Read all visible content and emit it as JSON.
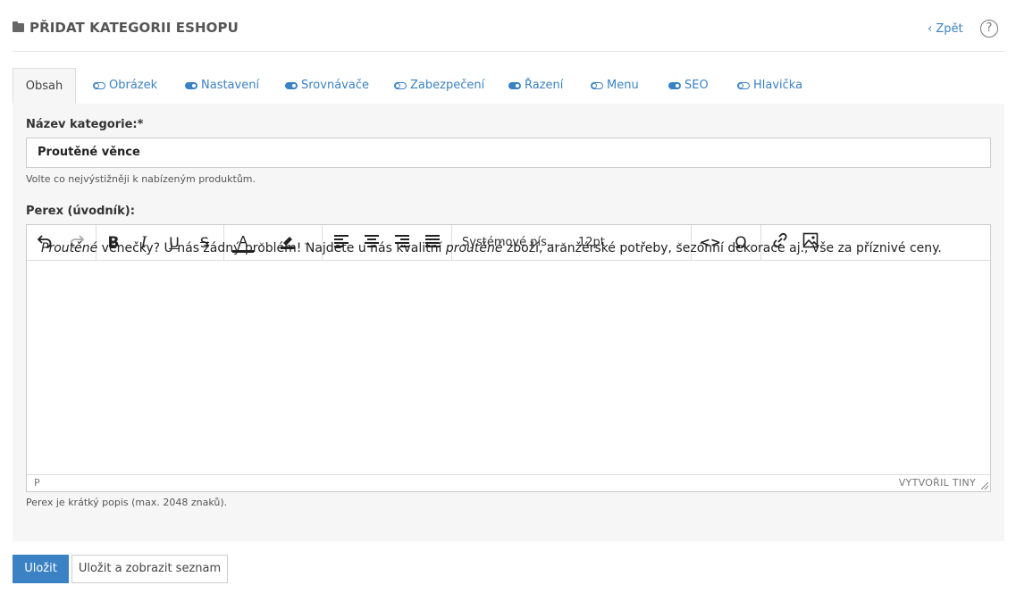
{
  "header": {
    "title": "PŘIDAT KATEGORII ESHOPU",
    "back_label": "‹ Zpět",
    "help_glyph": "?"
  },
  "tabs": [
    {
      "label": "Obsah",
      "active": true
    },
    {
      "label": "Obrázek",
      "toggle": "off"
    },
    {
      "label": "Nastavení",
      "toggle": "on"
    },
    {
      "label": "Srovnávače",
      "toggle": "on"
    },
    {
      "label": "Zabezpečení",
      "toggle": "off"
    },
    {
      "label": "Řazení",
      "toggle": "on"
    },
    {
      "label": "Menu",
      "toggle": "off"
    },
    {
      "label": "SEO",
      "toggle": "on"
    },
    {
      "label": "Hlavička",
      "toggle": "off"
    }
  ],
  "form": {
    "name_label": "Název kategorie:*",
    "name_value": "Proutěné věnce",
    "name_hint": "Volte co nejvýstižněji k nabízeným produktům.",
    "perex_label": "Perex (úvodník):",
    "perex_hint": "Perex je krátký popis (max. 2048 znaků)."
  },
  "editor": {
    "font_select": "Systémové pís...",
    "size_select": "12pt",
    "content_parts": [
      "Proutěné",
      " věnečky? U nás žádný problém! Najdete u nás kvalitní ",
      "proutěné",
      " zboží, aranžérské potřeby, sezónní dekorace aj., vše za příznivé ceny."
    ],
    "status_path": "P",
    "status_brand": "VYTVOŘIL TINY"
  },
  "actions": {
    "save_label": "Uložit",
    "save_list_label": "Uložit a zobrazit seznam"
  },
  "colors": {
    "accent": "#3b82c4",
    "panel_bg": "#f6f6f6"
  }
}
